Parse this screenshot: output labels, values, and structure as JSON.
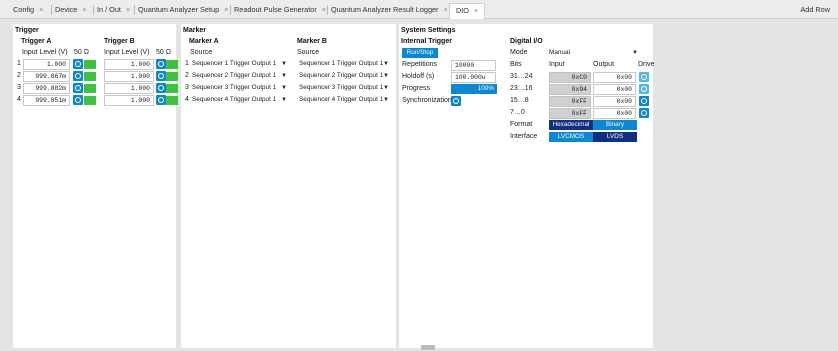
{
  "tabs": [
    {
      "label": "Config"
    },
    {
      "label": "Device"
    },
    {
      "label": "In / Out"
    },
    {
      "label": "Quantum Analyzer Setup"
    },
    {
      "label": "Readout Pulse Generator"
    },
    {
      "label": "Quantum Analyzer Result Logger"
    },
    {
      "label": "DIO"
    }
  ],
  "tab_close_glyph": "×",
  "add_row_label": "Add Row",
  "trigger": {
    "title": "Trigger",
    "a": {
      "title": "Trigger A",
      "col_level": "Input Level (V)",
      "col_50": "50 Ω",
      "rows": [
        {
          "n": "1",
          "v": "1.000"
        },
        {
          "n": "2",
          "v": "999.867m"
        },
        {
          "n": "3",
          "v": "999.882m"
        },
        {
          "n": "4",
          "v": "999.851m"
        }
      ]
    },
    "b": {
      "title": "Trigger B",
      "col_level": "Input Level (V)",
      "col_50": "50 Ω",
      "rows": [
        {
          "v": "1.000"
        },
        {
          "v": "1.000"
        },
        {
          "v": "1.000"
        },
        {
          "v": "1.000"
        }
      ]
    }
  },
  "marker": {
    "title": "Marker",
    "a": {
      "title": "Marker A",
      "col_source": "Source",
      "rows": [
        {
          "n": "1",
          "v": "Sequencer 1 Trigger Output 1"
        },
        {
          "n": "2",
          "v": "Sequencer 2 Trigger Output 1"
        },
        {
          "n": "3",
          "v": "Sequencer 3 Trigger Output 1"
        },
        {
          "n": "4",
          "v": "Sequencer 4 Trigger Output 1"
        }
      ]
    },
    "b": {
      "title": "Marker B",
      "col_source": "Source",
      "rows": [
        {
          "v": "Sequencer 1 Trigger Output 1"
        },
        {
          "v": "Sequencer 2 Trigger Output 1"
        },
        {
          "v": "Sequencer 3 Trigger Output 1"
        },
        {
          "v": "Sequencer 4 Trigger Output 1"
        }
      ]
    }
  },
  "system": {
    "title": "System Settings",
    "internal": {
      "title": "Internal Trigger",
      "run_label": "Run/Stop",
      "repetitions_label": "Repetitions",
      "repetitions": "10000",
      "holdoff_label": "Holdoff (s)",
      "holdoff": "100.000u",
      "progress_label": "Progress",
      "progress": "100%",
      "progress_fraction": 1.0,
      "sync_label": "Synchronization"
    },
    "dio": {
      "title": "Digital I/O",
      "mode_label": "Mode",
      "mode": "Manual",
      "bits_label": "Bits",
      "col_input": "Input",
      "col_output": "Output",
      "col_drive": "Drive",
      "rows": [
        {
          "bits": "31…24",
          "input": "0xC0",
          "output": "0x00"
        },
        {
          "bits": "23…16",
          "input": "0x94",
          "output": "0x00"
        },
        {
          "bits": "15…8",
          "input": "0xFF",
          "output": "0x00"
        },
        {
          "bits": "7…0",
          "input": "0xFF",
          "output": "0x00"
        }
      ],
      "format_label": "Format",
      "format_options": [
        "Hexadecimal",
        "Binary"
      ],
      "interface_label": "Interface",
      "interface_options": [
        "LVCMOS",
        "LVDS"
      ]
    }
  },
  "colors": {
    "accent": "#0a88d6",
    "navy": "#102e82",
    "led": "#3cc43c"
  }
}
